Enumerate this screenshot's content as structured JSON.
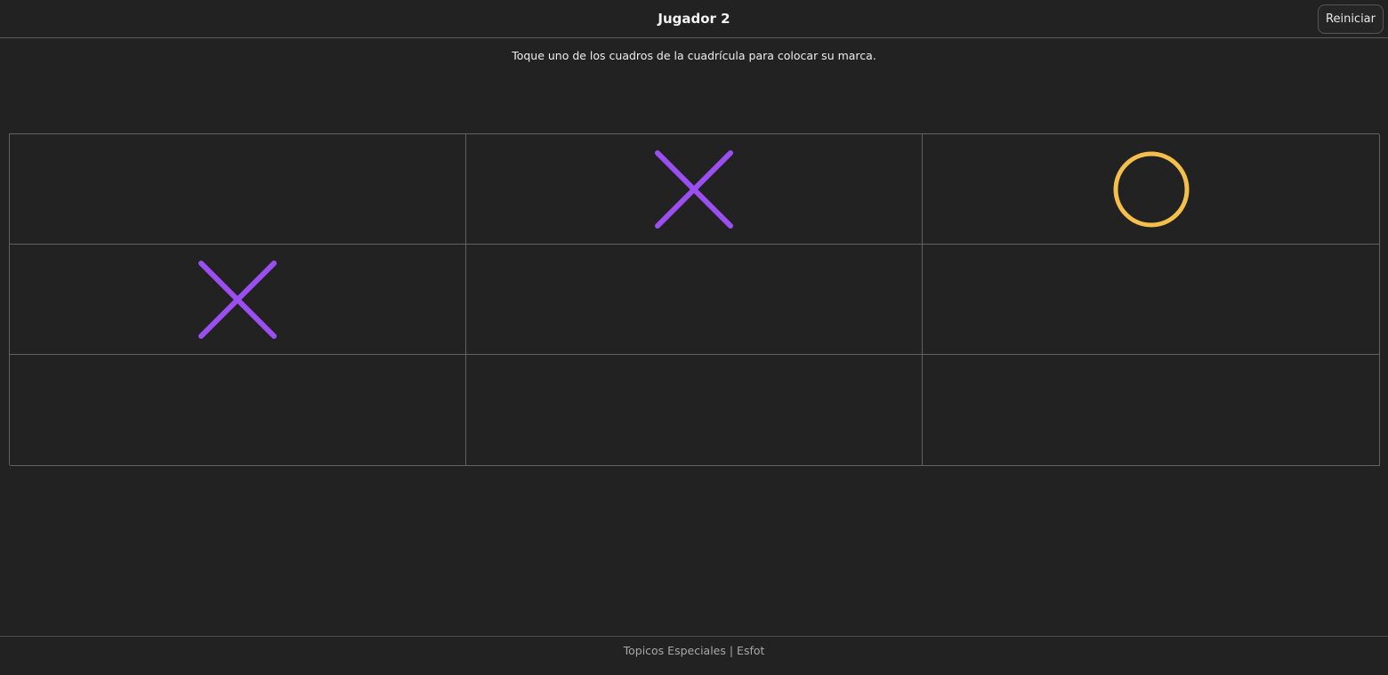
{
  "header": {
    "title": "Jugador 2",
    "restart_label": "Reiniciar"
  },
  "instructions": "Toque uno de los cuadros de la cuadrícula para colocar su marca.",
  "board": {
    "cells": [
      "",
      "X",
      "O",
      "X",
      "",
      "",
      "",
      "",
      ""
    ],
    "colors": {
      "x": "#9b4ff0",
      "o": "#f5c04a"
    }
  },
  "footer": {
    "text": "Topicos Especiales | Esfot"
  }
}
